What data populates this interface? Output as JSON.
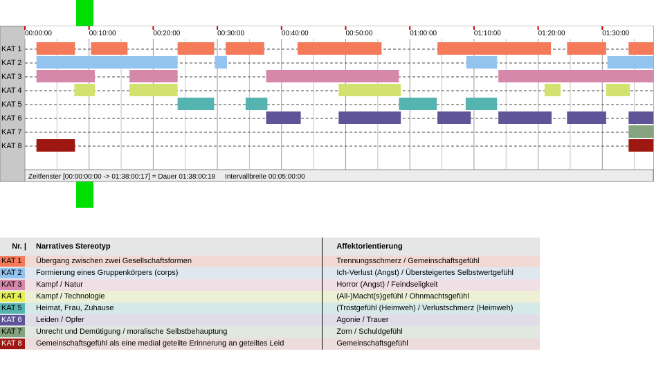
{
  "chart_data": {
    "type": "timeline",
    "x_unit": "hh:mm:ss",
    "x_range": [
      "00:00:00",
      "01:38:00"
    ],
    "tick_labels": [
      "00:00:00",
      "00:10:00",
      "00:20:00",
      "00:30:00",
      "00:40:00",
      "00:50:00",
      "01:00:00",
      "01:10:00",
      "01:20:00",
      "01:30:00"
    ],
    "tick_minutes": [
      0,
      10,
      20,
      30,
      40,
      50,
      60,
      70,
      80,
      90
    ],
    "rows": [
      {
        "label": "KAT 1",
        "color": "#f47a5a",
        "segments": [
          [
            1.8,
            7.8
          ],
          [
            10.3,
            16.0
          ],
          [
            23.8,
            29.5
          ],
          [
            31.3,
            37.3
          ],
          [
            42.5,
            55.6
          ],
          [
            64.3,
            82.0
          ],
          [
            84.5,
            90.6
          ],
          [
            94.1,
            98.0
          ]
        ]
      },
      {
        "label": "KAT 2",
        "color": "#93c3ef",
        "segments": [
          [
            1.8,
            23.8
          ],
          [
            29.6,
            31.5
          ],
          [
            68.8,
            73.6
          ],
          [
            90.8,
            98.0
          ]
        ]
      },
      {
        "label": "KAT 3",
        "color": "#d688aa",
        "segments": [
          [
            1.8,
            10.9
          ],
          [
            16.3,
            23.8
          ],
          [
            37.6,
            58.3
          ],
          [
            73.8,
            98.0
          ]
        ]
      },
      {
        "label": "KAT 4",
        "color": "#d3e16e",
        "segments": [
          [
            7.7,
            10.9
          ],
          [
            16.3,
            23.8
          ],
          [
            48.9,
            58.6
          ],
          [
            81.0,
            83.5
          ],
          [
            90.6,
            94.3
          ]
        ]
      },
      {
        "label": "KAT 5",
        "color": "#55b3b0",
        "segments": [
          [
            23.8,
            29.5
          ],
          [
            34.4,
            37.8
          ],
          [
            58.3,
            64.2
          ],
          [
            68.7,
            73.6
          ]
        ]
      },
      {
        "label": "KAT 6",
        "color": "#5e5497",
        "segments": [
          [
            37.6,
            43.0
          ],
          [
            48.9,
            58.6
          ],
          [
            64.3,
            69.5
          ],
          [
            73.8,
            82.1
          ],
          [
            84.5,
            90.6
          ],
          [
            94.1,
            98.0
          ]
        ]
      },
      {
        "label": "KAT 7",
        "color": "#85a37e",
        "segments": [
          [
            94.1,
            98.0
          ]
        ]
      },
      {
        "label": "KAT 8",
        "color": "#9e1710",
        "segments": [
          [
            1.8,
            7.8
          ],
          [
            94.1,
            98.0
          ]
        ]
      }
    ]
  },
  "status_text": "Zeitfenster [00:00:00:00 -> 01:38:00:17] = Dauer 01:38:00:18     Intervallbreite 00:05:00:00",
  "legend": {
    "header_nr": "Nr. |",
    "header_stereotyp": "Narratives Stereotyp",
    "header_affekt": "Affektorientierung",
    "rows": [
      {
        "nr": "KAT 1",
        "color": "#f47a5a",
        "text_color": "#000000",
        "bg": "#f3d9d3",
        "stereotyp": "Übergang zwischen zwei Gesellschaftsformen",
        "affekt": "Trennungsschmerz / Gemeinschaftsgefühl"
      },
      {
        "nr": "KAT 2",
        "color": "#93c3ef",
        "text_color": "#000000",
        "bg": "#dfe8f1",
        "stereotyp": "Formierung eines Gruppenkörpers (corps)",
        "affekt": "Ich-Verlust (Angst) / Übersteigertes Selbstwertgefühl"
      },
      {
        "nr": "KAT 3",
        "color": "#d688aa",
        "text_color": "#000000",
        "bg": "#f1dfe6",
        "stereotyp": "Kampf / Natur",
        "affekt": "Horror (Angst) / Feindseligkeit"
      },
      {
        "nr": "KAT 4",
        "color": "#e5ef56",
        "text_color": "#000000",
        "bg": "#eef0d6",
        "stereotyp": "Kampf / Technologie",
        "affekt": "(All-)Macht(s)gefühl / Ohnmachtsgefühl"
      },
      {
        "nr": "KAT 5",
        "color": "#55b3b0",
        "text_color": "#000000",
        "bg": "#d5eae8",
        "stereotyp": "Heimat, Frau, Zuhause",
        "affekt": "(Trostgefühl (Heimweh) / Verlustschmerz (Heimweh)"
      },
      {
        "nr": "KAT 6",
        "color": "#5e5497",
        "text_color": "#ffffff",
        "bg": "#e0dde9",
        "stereotyp": "Leiden / Opfer",
        "affekt": "Agonie / Trauer"
      },
      {
        "nr": "KAT 7",
        "color": "#85a37e",
        "text_color": "#000000",
        "bg": "#e1e8df",
        "stereotyp": "Unrecht und Demütigung / moralische Selbstbehauptung",
        "affekt": "Zorn / Schuldgefühl"
      },
      {
        "nr": "KAT 8",
        "color": "#9e1710",
        "text_color": "#ffffff",
        "bg": "#ecdcdb",
        "stereotyp": "Gemeinschaftsgefühl als eine medial geteilte Erinnerung an geteiltes Leid",
        "affekt": "Gemeinschaftsgefühl"
      }
    ]
  }
}
